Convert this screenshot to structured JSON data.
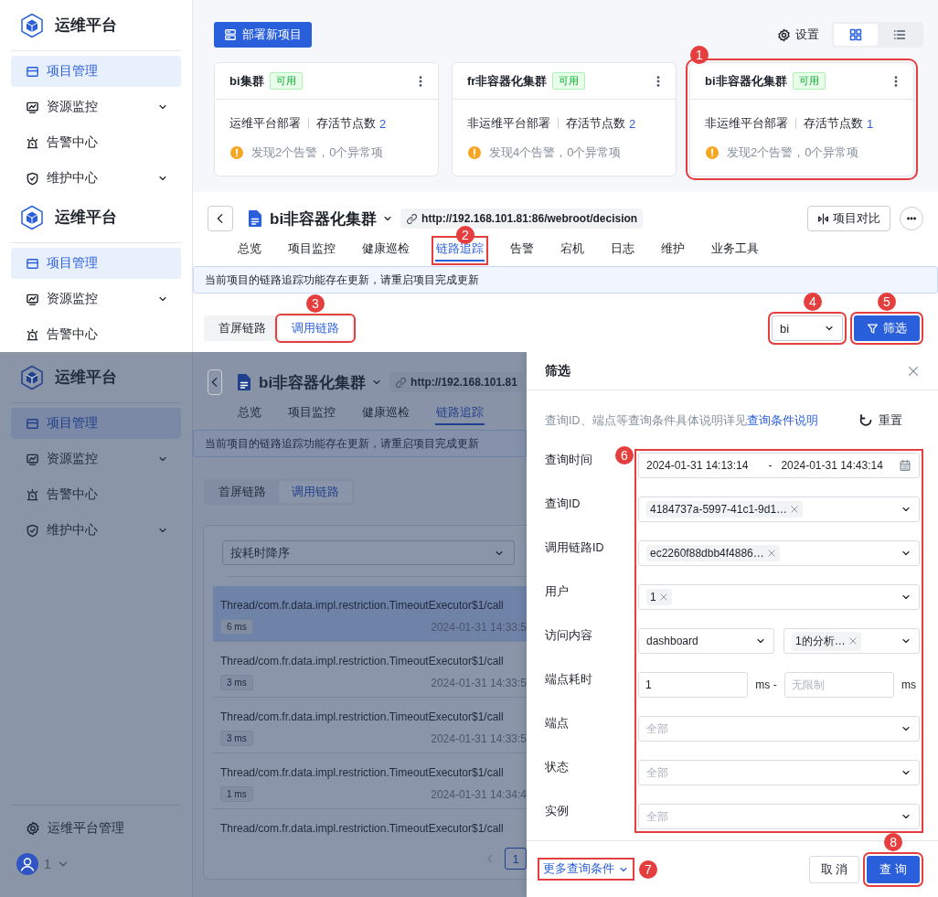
{
  "overview_screen": {
    "sidebar": {
      "logo": "运维平台",
      "items": [
        {
          "label": "项目管理",
          "kind": "project",
          "selected": true,
          "expandable": false
        },
        {
          "label": "资源监控",
          "kind": "monitor",
          "selected": false,
          "expandable": true
        },
        {
          "label": "告警中心",
          "kind": "alarm",
          "selected": false,
          "expandable": false
        },
        {
          "label": "维护中心",
          "kind": "maintain",
          "selected": false,
          "expandable": true
        }
      ]
    },
    "deploy_button": "部署新项目",
    "settings": "设置",
    "view_modes": [
      {
        "kind": "grid",
        "selected": true
      },
      {
        "kind": "list",
        "selected": false
      }
    ],
    "cards": [
      {
        "name": "bi集群",
        "status": "可用",
        "deploy_type": "运维平台部署",
        "alive_label": "存活节点数",
        "alive_count": "2",
        "warning": "发现2个告警，0个异常项"
      },
      {
        "name": "fr非容器化集群",
        "status": "可用",
        "deploy_type": "非运维平台部署",
        "alive_label": "存活节点数",
        "alive_count": "2",
        "warning": "发现4个告警，0个异常项"
      },
      {
        "name": "bi非容器化集群",
        "status": "可用",
        "deploy_type": "非运维平台部署",
        "alive_label": "存活节点数",
        "alive_count": "1",
        "warning": "发现2个告警，0个异常项",
        "annotation": "1"
      }
    ]
  },
  "trace_screen": {
    "sidebar": {
      "logo": "运维平台",
      "items": [
        {
          "label": "项目管理",
          "kind": "project",
          "selected": true,
          "expandable": false
        },
        {
          "label": "资源监控",
          "kind": "monitor",
          "selected": false,
          "expandable": true
        },
        {
          "label": "告警中心",
          "kind": "alarm",
          "selected": false,
          "expandable": false
        }
      ]
    },
    "project_title": "bi非容器化集群",
    "url": "http://192.168.101.81:86/webroot/decision",
    "compare_button": "项目对比",
    "tabs": [
      {
        "label": "总览",
        "selected": false
      },
      {
        "label": "项目监控",
        "selected": false
      },
      {
        "label": "健康巡检",
        "selected": false
      },
      {
        "label": "链路追踪",
        "selected": true,
        "annotation": "2"
      },
      {
        "label": "告警",
        "selected": false
      },
      {
        "label": "宕机",
        "selected": false
      },
      {
        "label": "日志",
        "selected": false
      },
      {
        "label": "维护",
        "selected": false
      },
      {
        "label": "业务工具",
        "selected": false
      }
    ],
    "notice": "当前项目的链路追踪功能存在更新，请重启项目完成更新",
    "subtabs": [
      {
        "label": "首屏链路",
        "selected": false
      },
      {
        "label": "调用链路",
        "selected": true,
        "annotation": "3"
      }
    ],
    "instance_select": {
      "value": "bi",
      "annotation": "4"
    },
    "filter_button": {
      "label": "筛选",
      "annotation": "5"
    }
  },
  "filter_screen": {
    "sidebar": {
      "logo": "运维平台",
      "items": [
        {
          "label": "项目管理",
          "kind": "project",
          "selected": true,
          "expandable": false
        },
        {
          "label": "资源监控",
          "kind": "monitor",
          "selected": false,
          "expandable": true
        },
        {
          "label": "告警中心",
          "kind": "alarm",
          "selected": false,
          "expandable": false
        },
        {
          "label": "维护中心",
          "kind": "maintain",
          "selected": false,
          "expandable": true
        }
      ],
      "admin": "运维平台管理",
      "user": "1"
    },
    "project_title": "bi非容器化集群",
    "url": "http://192.168.101.81",
    "tabs": [
      {
        "label": "总览",
        "selected": false
      },
      {
        "label": "项目监控",
        "selected": false
      },
      {
        "label": "健康巡检",
        "selected": false
      },
      {
        "label": "链路追踪",
        "selected": true
      }
    ],
    "notice": "当前项目的链路追踪功能存在更新，请重启项目完成更新",
    "subtabs": [
      {
        "label": "首屏链路",
        "selected": false
      },
      {
        "label": "调用链路",
        "selected": true
      }
    ],
    "sort_select": "按耗时降序",
    "traces": [
      {
        "title": "Thread/com.fr.data.impl.restriction.TimeoutExecutor$1/call",
        "duration": "6 ms",
        "time": "2024-01-31 14:33:5",
        "selected": true
      },
      {
        "title": "Thread/com.fr.data.impl.restriction.TimeoutExecutor$1/call",
        "duration": "3 ms",
        "time": "2024-01-31 14:33:5",
        "selected": false
      },
      {
        "title": "Thread/com.fr.data.impl.restriction.TimeoutExecutor$1/call",
        "duration": "3 ms",
        "time": "2024-01-31 14:33:5",
        "selected": false
      },
      {
        "title": "Thread/com.fr.data.impl.restriction.TimeoutExecutor$1/call",
        "duration": "1 ms",
        "time": "2024-01-31 14:34:4",
        "selected": false
      },
      {
        "title": "Thread/com.fr.data.impl.restriction.TimeoutExecutor$1/call",
        "selected": false
      }
    ],
    "pages": [
      {
        "label": "1",
        "selected": true
      }
    ],
    "drawer": {
      "title": "筛选",
      "hint": "查询ID、端点等查询条件具体说明详见",
      "hint_link": "查询条件说明",
      "reset": "重置",
      "fields_annotation": "6",
      "fields": [
        {
          "kind": "date_range",
          "label": "查询时间",
          "start": "2024-01-31 14:13:14",
          "separator": "-",
          "end": "2024-01-31 14:43:14"
        },
        {
          "kind": "tag_select",
          "label": "查询ID",
          "tags": [
            "4184737a-5997-41c1-9d1…"
          ]
        },
        {
          "kind": "tag_select",
          "label": "调用链路ID",
          "tags": [
            "ec2260f88dbb4f4886…"
          ]
        },
        {
          "kind": "tag_select",
          "label": "用户",
          "tags": [
            "1"
          ]
        },
        {
          "kind": "select_pair",
          "label": "访问内容",
          "value": "dashboard",
          "tags": [
            "1的分析…"
          ]
        },
        {
          "kind": "number_range",
          "label": "端点耗时",
          "min": "1",
          "min_unit": "ms -",
          "max_placeholder": "无限制",
          "max_unit": "ms"
        },
        {
          "kind": "select",
          "label": "端点",
          "placeholder": "全部"
        },
        {
          "kind": "select",
          "label": "状态",
          "placeholder": "全部"
        },
        {
          "kind": "select",
          "label": "实例",
          "placeholder": "全部"
        }
      ],
      "more_conditions": {
        "label": "更多查询条件",
        "annotation": "7"
      },
      "cancel_button": "取 消",
      "query_button": {
        "label": "查 询",
        "annotation": "8"
      }
    }
  }
}
